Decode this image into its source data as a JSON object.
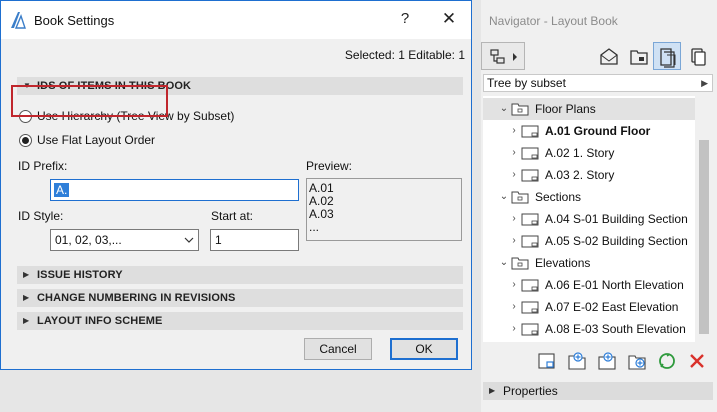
{
  "dialog": {
    "title": "Book Settings",
    "help_label": "?",
    "close_label": "✕",
    "selected_info": "Selected: 1 Editable: 1",
    "ids_section": "IDS OF ITEMS IN THIS BOOK",
    "radio_hierarchy": "Use Hierarchy (Tree View by Subset)",
    "radio_flat": "Use Flat Layout Order",
    "id_prefix_label": "ID Prefix:",
    "id_prefix_value": "A.",
    "preview_label": "Preview:",
    "preview_lines": [
      "A.01",
      "A.02",
      "A.03",
      "..."
    ],
    "id_style_label": "ID Style:",
    "id_style_value": "01, 02, 03,...",
    "start_at_label": "Start at:",
    "start_at_value": "1",
    "issue_history": "ISSUE HISTORY",
    "change_numbering": "CHANGE NUMBERING IN REVISIONS",
    "layout_info": "LAYOUT INFO SCHEME",
    "cancel_label": "Cancel",
    "ok_label": "OK",
    "accent_color": "#1e6fd0",
    "highlight_color": "#c0262c"
  },
  "navigator": {
    "title": "Navigator - Layout Book",
    "combo_value": "Tree by subset",
    "tree": [
      {
        "label": "Floor Plans",
        "type": "folder",
        "expanded": true,
        "level": 0
      },
      {
        "label": "A.01 Ground Floor",
        "type": "layout",
        "level": 1,
        "bold": true
      },
      {
        "label": "A.02 1. Story",
        "type": "layout",
        "level": 1
      },
      {
        "label": "A.03 2. Story",
        "type": "layout",
        "level": 1
      },
      {
        "label": "Sections",
        "type": "folder",
        "expanded": true,
        "level": 0
      },
      {
        "label": "A.04 S-01 Building Section",
        "type": "layout",
        "level": 1
      },
      {
        "label": "A.05 S-02 Building Section",
        "type": "layout",
        "level": 1
      },
      {
        "label": "Elevations",
        "type": "folder",
        "expanded": true,
        "level": 0
      },
      {
        "label": "A.06 E-01 North Elevation",
        "type": "layout",
        "level": 1
      },
      {
        "label": "A.07 E-02 East Elevation",
        "type": "layout",
        "level": 1
      },
      {
        "label": "A.08 E-03 South Elevation",
        "type": "layout",
        "level": 1
      }
    ],
    "properties_label": "Properties"
  }
}
